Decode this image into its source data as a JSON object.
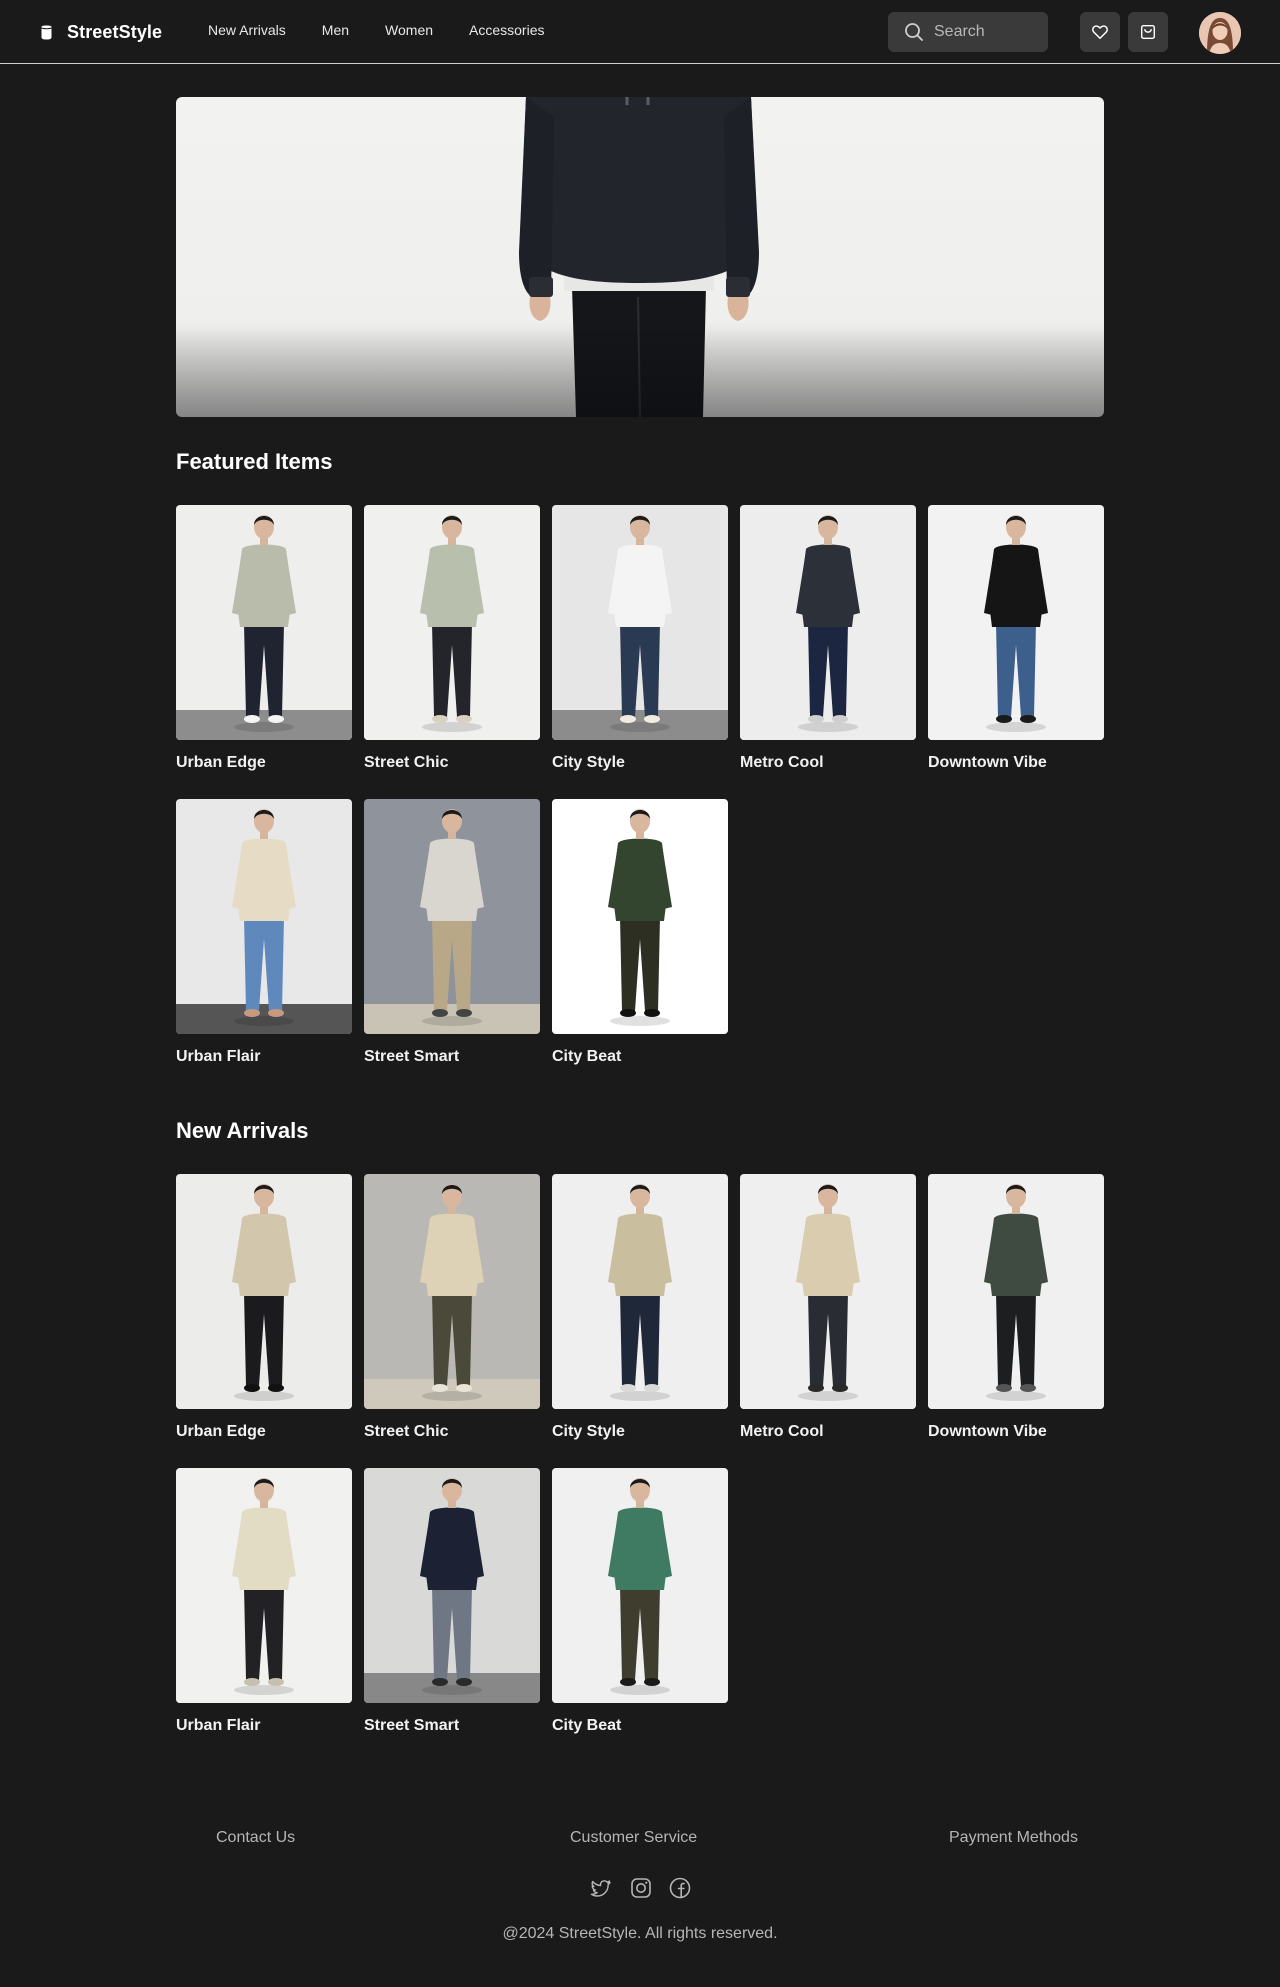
{
  "header": {
    "brand": "StreetStyle",
    "nav": [
      "New Arrivals",
      "Men",
      "Women",
      "Accessories"
    ],
    "search_placeholder": "Search",
    "icons": [
      "heart-icon",
      "cart-icon"
    ]
  },
  "colors": {
    "background": "#1a1a1a",
    "surface": "#3a3a3a",
    "text": "#ffffff",
    "muted": "#b5b5b5"
  },
  "featured": {
    "title": "Featured Items",
    "items": [
      {
        "name": "Urban Edge",
        "bg": "#eeeeec",
        "floor": "#8d8d8d",
        "top": "#b9bcaa",
        "bottom": "#1f2430",
        "shoes": "#f4f4f4"
      },
      {
        "name": "Street Chic",
        "bg": "#f0f0ef",
        "floor": "#f0f0ef",
        "top": "#b8c0ad",
        "bottom": "#23252b",
        "shoes": "#d8d2c0"
      },
      {
        "name": "City Style",
        "bg": "#e6e6e6",
        "floor": "#8c8c8c",
        "top": "#f4f4f4",
        "bottom": "#2a3a52",
        "shoes": "#f0ede0"
      },
      {
        "name": "Metro Cool",
        "bg": "#ededed",
        "floor": "#ededed",
        "top": "#2c3038",
        "bottom": "#1c2640",
        "shoes": "#cfcfcf"
      },
      {
        "name": "Downtown Vibe",
        "bg": "#f2f2f2",
        "floor": "#f2f2f2",
        "top": "#151515",
        "bottom": "#3c5f8c",
        "shoes": "#1a1a1a"
      },
      {
        "name": "Urban Flair",
        "bg": "#e8e8e8",
        "floor": "#555555",
        "top": "#e6dcc6",
        "bottom": "#5f88bd",
        "shoes": "#c79a80"
      },
      {
        "name": "Street Smart",
        "bg": "#8f939c",
        "floor": "#c9c3b5",
        "top": "#d9d6cf",
        "bottom": "#b9a888",
        "shoes": "#444444"
      },
      {
        "name": "City Beat",
        "bg": "#ffffff",
        "floor": "#ffffff",
        "top": "#34452f",
        "bottom": "#2c2f22",
        "shoes": "#111111"
      }
    ]
  },
  "arrivals": {
    "title": "New Arrivals",
    "items": [
      {
        "name": "Urban Edge",
        "bg": "#ececea",
        "floor": "#ececea",
        "top": "#d2c7ad",
        "bottom": "#1b1b1d",
        "shoes": "#111111"
      },
      {
        "name": "Street Chic",
        "bg": "#b9b8b4",
        "floor": "#cfc9bb",
        "top": "#ddd2b6",
        "bottom": "#4b4a3a",
        "shoes": "#e9e4d8"
      },
      {
        "name": "City Style",
        "bg": "#efefef",
        "floor": "#efefef",
        "top": "#c9bf9f",
        "bottom": "#1f2838",
        "shoes": "#d9d9d9"
      },
      {
        "name": "Metro Cool",
        "bg": "#efefef",
        "floor": "#efefef",
        "top": "#d9ccaf",
        "bottom": "#2a2c33",
        "shoes": "#2a2a2a"
      },
      {
        "name": "Downtown Vibe",
        "bg": "#f0f0f0",
        "floor": "#f0f0f0",
        "top": "#3f4a40",
        "bottom": "#1d1e20",
        "shoes": "#555555"
      },
      {
        "name": "Urban Flair",
        "bg": "#f1f1f0",
        "floor": "#f1f1f0",
        "top": "#e2dcc4",
        "bottom": "#222225",
        "shoes": "#c7c0ae"
      },
      {
        "name": "Street Smart",
        "bg": "#d9d9d7",
        "floor": "#888888",
        "top": "#1c2233",
        "bottom": "#6f7684",
        "shoes": "#2a2a2a"
      },
      {
        "name": "City Beat",
        "bg": "#f0f0f0",
        "floor": "#f0f0f0",
        "top": "#3f7a63",
        "bottom": "#3f3d2d",
        "shoes": "#1a1a1a"
      }
    ]
  },
  "footer": {
    "links": [
      "Contact Us",
      "Customer Service",
      "Payment Methods"
    ],
    "social": [
      "twitter-icon",
      "instagram-icon",
      "facebook-icon"
    ],
    "copyright": "@2024 StreetStyle. All rights reserved."
  }
}
